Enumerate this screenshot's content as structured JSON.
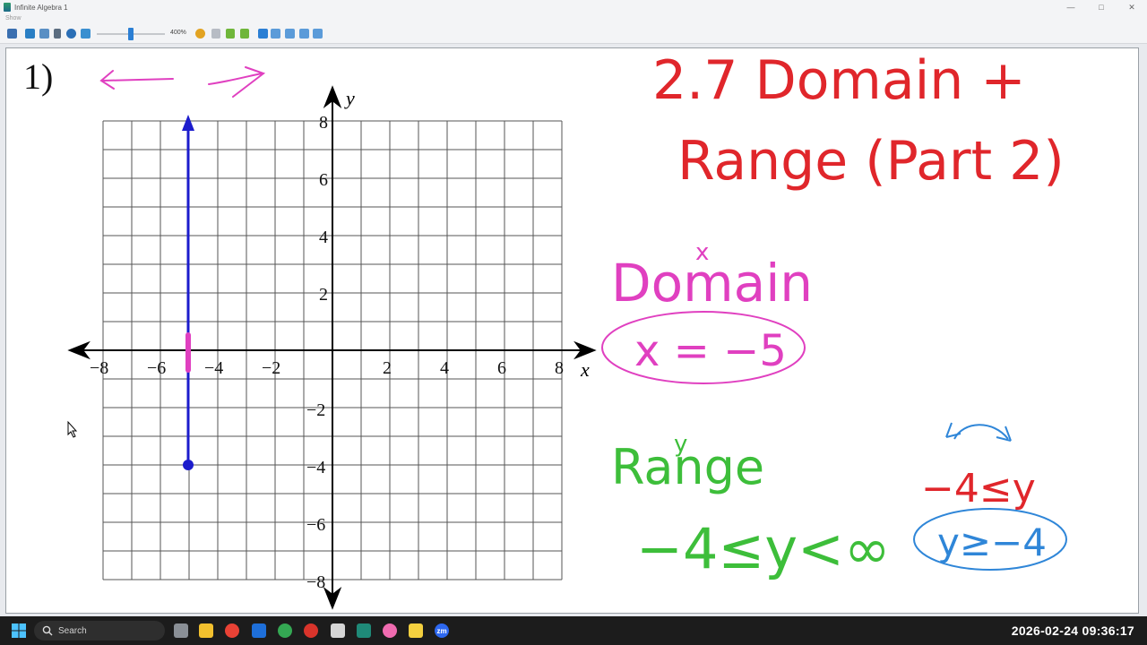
{
  "window": {
    "title": "Infinite Algebra 1",
    "minimize": "—",
    "maximize": "□",
    "close": "✕"
  },
  "menu": {
    "show": "Show"
  },
  "toolbar": {
    "zoom_label": "400%"
  },
  "problem": {
    "number": "1)"
  },
  "graph": {
    "x_label": "x",
    "y_label": "y",
    "x_ticks": [
      "−8",
      "−6",
      "−4",
      "−2",
      "2",
      "4",
      "6",
      "8"
    ],
    "y_ticks": [
      "8",
      "6",
      "4",
      "2",
      "−2",
      "−4",
      "−6",
      "−8"
    ]
  },
  "notes": {
    "title_line1": "2.7 Domain +",
    "title_line2": "Range (Part 2)",
    "domain_var": "x",
    "domain_label": "Domain",
    "domain_answer": "x = −5",
    "range_var": "y",
    "range_label": "Range",
    "range_answer": "−4≤y<∞",
    "side_ineq1": "−4≤y",
    "side_ineq2": "y≥−4"
  },
  "taskbar": {
    "search_placeholder": "Search",
    "clock": "2026-02-24 09:36:17",
    "zoom_app": "zm"
  },
  "colors": {
    "red_ink": "#e0262b",
    "pink_ink": "#e040c0",
    "green_ink": "#3dbe3a",
    "blue_ink": "#2f86d8",
    "graph_line": "#1c1ccc"
  }
}
